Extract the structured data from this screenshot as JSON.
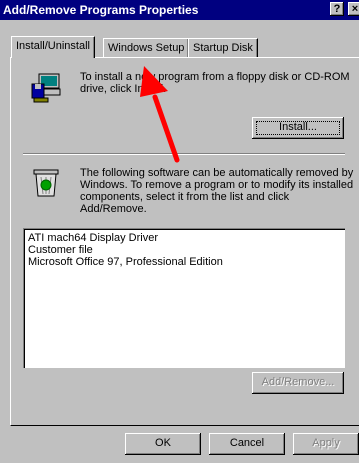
{
  "window": {
    "title": "Add/Remove Programs Properties",
    "help_label": "?",
    "close_label": "×"
  },
  "tabs": [
    {
      "label": "Install/Uninstall",
      "active": true
    },
    {
      "label": "Windows Setup",
      "active": false
    },
    {
      "label": "Startup Disk",
      "active": false
    }
  ],
  "install_section": {
    "description": "To install a new program from a floppy disk or CD-ROM drive, click Install.",
    "line1": "To install a new program from a floppy disk or CD-ROM",
    "line2": "drive, click Install.",
    "button_label": "Install..."
  },
  "remove_section": {
    "line1": "The following software can be automatically removed by",
    "line2": "Windows. To remove a program or to modify its installed",
    "line3": "components, select it from the list and click",
    "line4": "Add/Remove.",
    "programs": [
      "ATI mach64 Display Driver",
      "Customer file",
      "Microsoft Office 97, Professional Edition"
    ],
    "button_label": "Add/Remove..."
  },
  "footer": {
    "ok_label": "OK",
    "cancel_label": "Cancel",
    "apply_label": "Apply"
  },
  "annotation": {
    "color": "#ff0000"
  }
}
